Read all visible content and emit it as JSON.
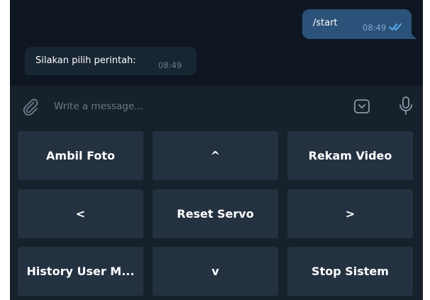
{
  "chat": {
    "outgoing": {
      "text": "/start",
      "time": "08:49"
    },
    "incoming": {
      "text": "Silakan pilih perintah:",
      "time": "08:49"
    }
  },
  "input": {
    "placeholder": "Write a message...",
    "value": ""
  },
  "icons": {
    "attach": "paperclip-icon",
    "emoji": "emoji-keyboard-icon",
    "mic": "microphone-icon",
    "read": "double-check-icon"
  },
  "keyboard": {
    "buttons": [
      "Ambil Foto",
      "^",
      "Rekam Video",
      "<",
      "Reset Servo",
      ">",
      "History User M...",
      "v",
      "Stop Sistem"
    ]
  },
  "colors": {
    "chat_background": "#0e1621",
    "panel": "#17212b",
    "outgoing_bubble": "#2b5278",
    "incoming_bubble": "#182533",
    "keyboard_button": "#243141",
    "read_tick": "#5eb5f7"
  }
}
